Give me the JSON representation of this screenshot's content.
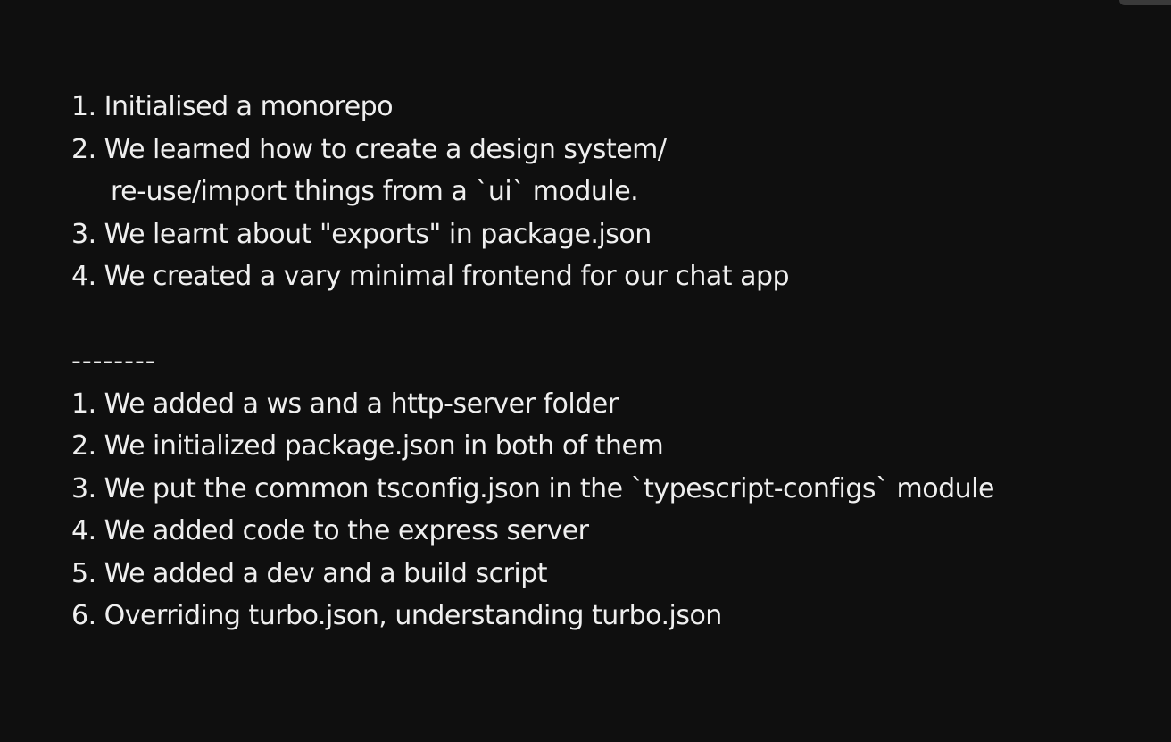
{
  "notes": {
    "section1": {
      "line1": "1. Initialised a monorepo",
      "line2": "2. We learned how to create a design system/",
      "line2_continued": "re-use/import things from a `ui` module.",
      "line3": "3. We learnt about \"exports\" in package.json",
      "line4": "4. We created a vary minimal frontend for our chat app"
    },
    "separator": "--------",
    "section2": {
      "line1": "1. We added a ws and a http-server folder",
      "line2": "2. We initialized package.json in both of them",
      "line3": "3. We put the common tsconfig.json in the `typescript-configs` module",
      "line4": "4. We added code to the express server",
      "line5": "5. We added a dev and a build script",
      "line6": "6. Overriding turbo.json, understanding turbo.json"
    }
  },
  "colors": {
    "background": "#0f0f0f",
    "text": "#efefef"
  }
}
